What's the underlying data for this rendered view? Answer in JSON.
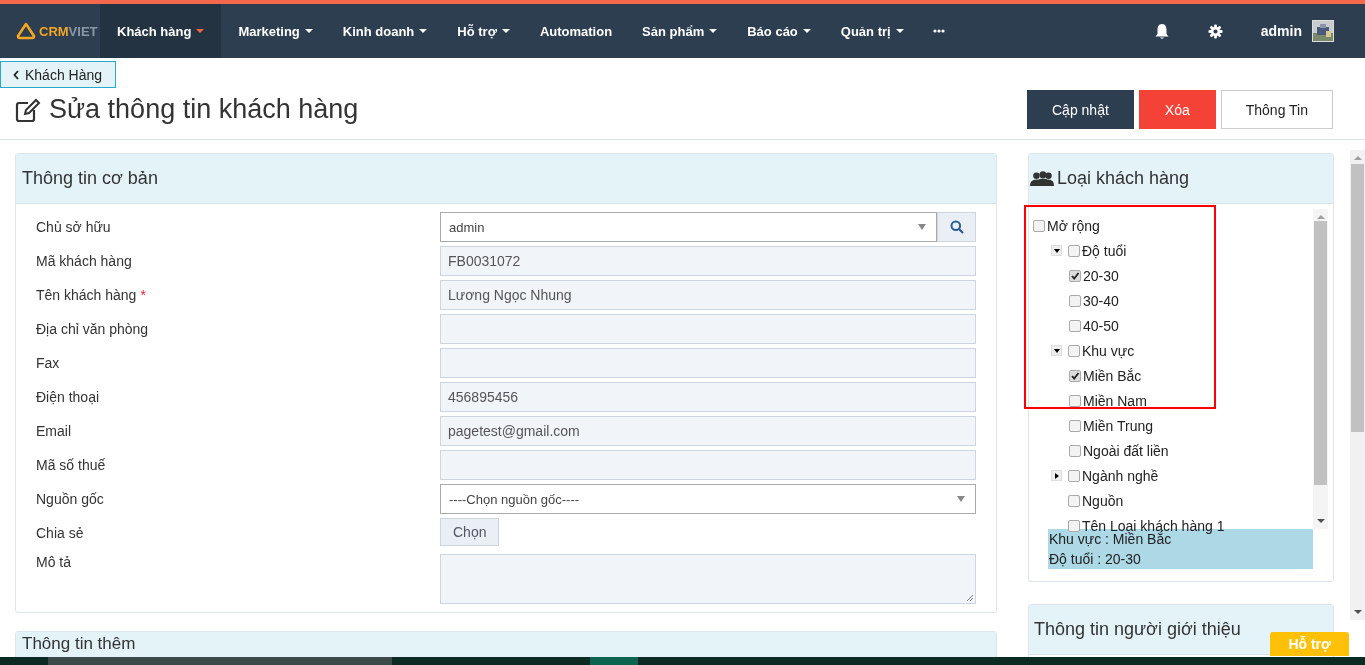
{
  "nav": {
    "logo": {
      "brand": "CRM",
      "suffix": "VIET"
    },
    "items": [
      {
        "label": "Khách hàng",
        "caret": true,
        "selected": true
      },
      {
        "label": "Marketing",
        "caret": true,
        "selected": false
      },
      {
        "label": "Kinh doanh",
        "caret": true,
        "selected": false
      },
      {
        "label": "Hỗ trợ",
        "caret": true,
        "selected": false
      },
      {
        "label": "Automation",
        "caret": false,
        "selected": false
      },
      {
        "label": "Sản phẩm",
        "caret": true,
        "selected": false
      },
      {
        "label": "Báo cáo",
        "caret": true,
        "selected": false
      },
      {
        "label": "Quản trị",
        "caret": true,
        "selected": false
      }
    ],
    "user": "admin"
  },
  "back_link": "Khách Hàng",
  "page_title": "Sửa thông tin khách hàng",
  "actions": [
    {
      "label": "Cập nhật",
      "kind": "primary"
    },
    {
      "label": "Xóa",
      "kind": "danger"
    },
    {
      "label": "Thông Tin",
      "kind": "default"
    }
  ],
  "basic_info": {
    "title": "Thông tin cơ bản",
    "fields": [
      {
        "label": "Chủ sở hữu",
        "kind": "select_search",
        "value": "admin"
      },
      {
        "label": "Mã khách hàng",
        "kind": "input",
        "value": "FB0031072"
      },
      {
        "label": "Tên khách hàng",
        "kind": "input",
        "value": "Lương Ngọc Nhung",
        "required_mark": "*"
      },
      {
        "label": "Địa chỉ văn phòng",
        "kind": "input"
      },
      {
        "label": "Fax",
        "kind": "input"
      },
      {
        "label": "Điện thoại",
        "kind": "input",
        "value": "456895456"
      },
      {
        "label": "Email",
        "kind": "input",
        "value": "pagetest@gmail.com"
      },
      {
        "label": "Mã số thuế",
        "kind": "input"
      },
      {
        "label": "Nguồn gốc",
        "kind": "select",
        "value": "----Chọn nguồn gốc----"
      },
      {
        "label": "Chia sẻ",
        "kind": "button",
        "value": "Chọn"
      },
      {
        "label": "Mô tả",
        "kind": "textarea"
      }
    ]
  },
  "more_info": {
    "title": "Thông tin thêm"
  },
  "customer_type": {
    "title": "Loại khách hàng",
    "tree": [
      {
        "label": "Mở rộng",
        "checked": false,
        "children": [
          {
            "label": "Độ tuổi",
            "checked": false,
            "expanded": true,
            "children": [
              {
                "label": "20-30",
                "checked": true
              },
              {
                "label": "30-40",
                "checked": false
              },
              {
                "label": "40-50",
                "checked": false
              }
            ]
          },
          {
            "label": "Khu vực",
            "checked": false,
            "expanded": true,
            "children": [
              {
                "label": "Miền Bắc",
                "checked": true
              },
              {
                "label": "Miền Nam",
                "checked": false
              },
              {
                "label": "Miền Trung",
                "checked": false
              },
              {
                "label": "Ngoài đất liền",
                "checked": false
              }
            ]
          },
          {
            "label": "Ngành nghề",
            "checked": false,
            "expanded": false
          },
          {
            "label": "Nguồn",
            "checked": false
          },
          {
            "label": "Tên Loại khách hàng 1",
            "checked": false
          }
        ]
      }
    ],
    "summary": [
      "Khu vực : Miền Bắc",
      "Độ tuổi : 20-30"
    ]
  },
  "referrer": {
    "title": "Thông tin người giới thiệu"
  },
  "help_button": "Hỗ trợ"
}
